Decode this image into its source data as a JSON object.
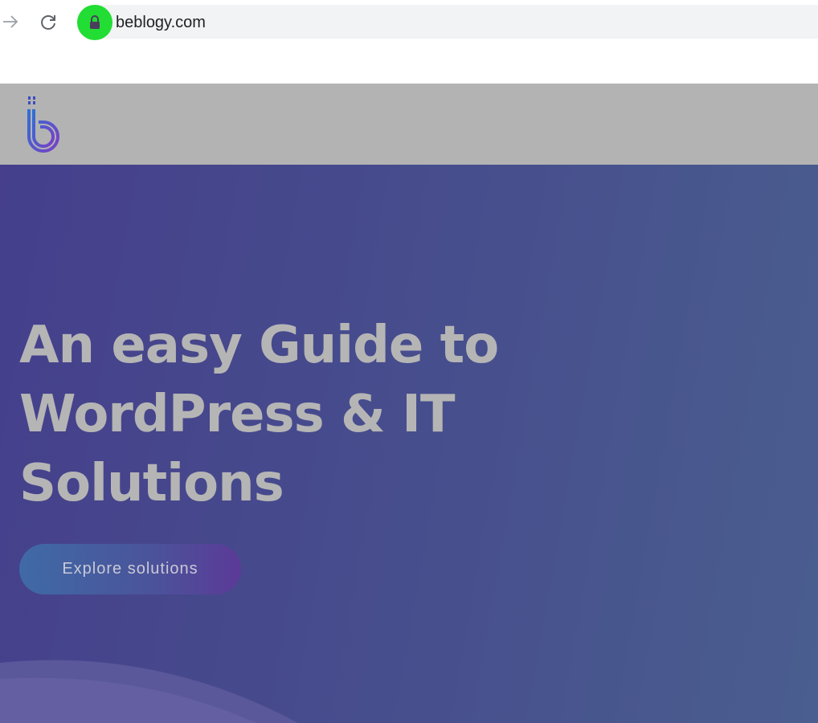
{
  "browser": {
    "url": "beblogy.com",
    "icons": {
      "forward": "arrow-forward-icon",
      "reload": "reload-icon",
      "lock": "lock-icon"
    },
    "highlight_color": "#22dd33"
  },
  "site": {
    "header_bg": "#b3b3b3",
    "logo": "beblogy-logo"
  },
  "hero": {
    "title_line1": "An easy Guide to",
    "title_line2": "WordPress & IT",
    "title_line3": "Solutions",
    "cta_label": "Explore solutions",
    "colors": {
      "bg_start": "#453f8c",
      "bg_end": "#4a5e8f",
      "title": "#b5b5b5",
      "cta_start": "#3f6aa6",
      "cta_end": "#5b3a98"
    }
  }
}
